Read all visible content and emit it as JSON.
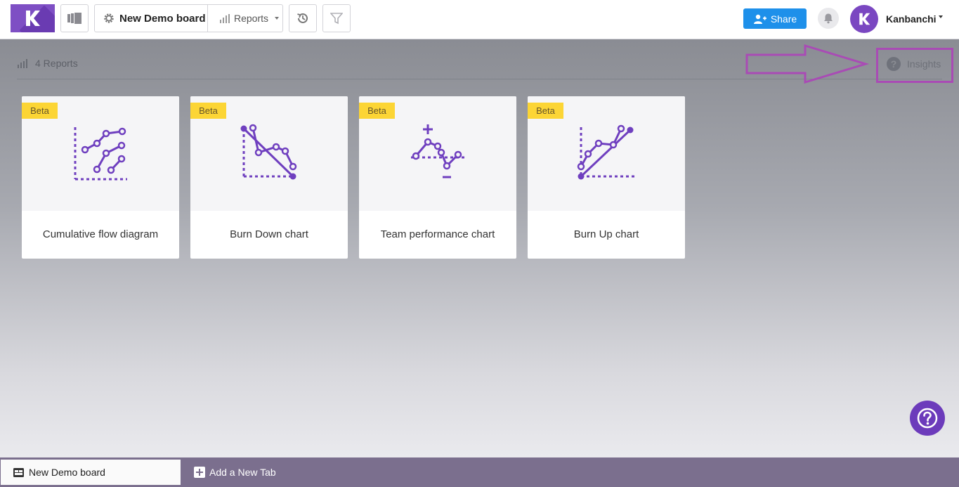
{
  "header": {
    "logo_icon": "kanbanchi-logo-icon",
    "board_title": "New Demo board",
    "reports_label": "Reports",
    "share_label": "Share",
    "user_name": "Kanbanchi",
    "brand_color": "#7e4fc4",
    "share_color": "#1e90ea"
  },
  "reports": {
    "count_label": "4 Reports",
    "insights_label": "Insights",
    "cards": [
      {
        "badge": "Beta",
        "title": "Cumulative flow diagram",
        "icon": "cumulative-flow-icon"
      },
      {
        "badge": "Beta",
        "title": "Burn Down chart",
        "icon": "burn-down-icon"
      },
      {
        "badge": "Beta",
        "title": "Team performance chart",
        "icon": "team-performance-icon"
      },
      {
        "badge": "Beta",
        "title": "Burn Up chart",
        "icon": "burn-up-icon"
      }
    ]
  },
  "tabs": {
    "active_tab": "New Demo board",
    "add_tab_label": "Add a New Tab"
  },
  "colors": {
    "accent_purple": "#6c3bbb",
    "beta_yellow": "#fcd535",
    "annotation": "#a94bb5"
  }
}
